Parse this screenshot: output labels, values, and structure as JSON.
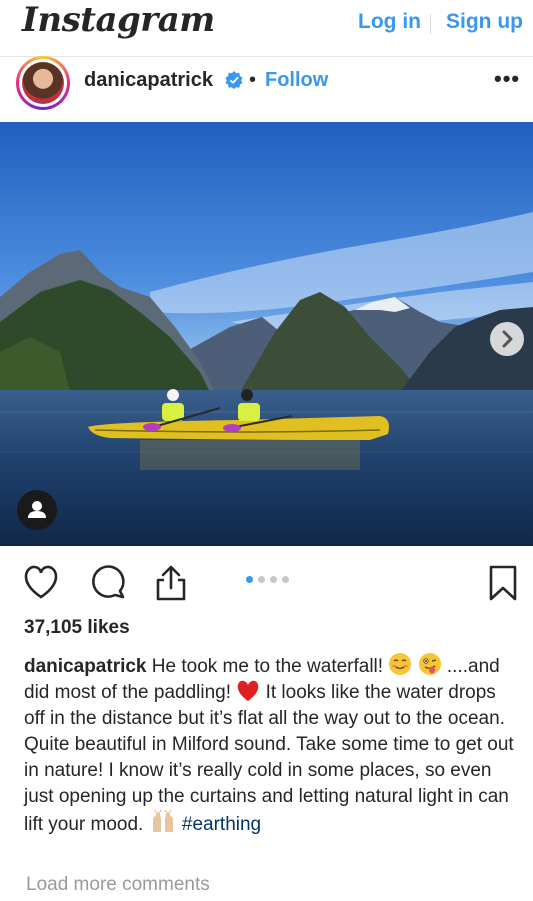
{
  "header": {
    "logo": "Instagram",
    "login": "Log in",
    "signup": "Sign up"
  },
  "post": {
    "username": "danicapatrick",
    "dot": "•",
    "follow": "Follow",
    "more": "•••",
    "carousel": {
      "total": 4,
      "active": 1
    }
  },
  "likes": "37,105 likes",
  "caption": {
    "username": "danicapatrick",
    "text1": " He took me to the waterfall! ",
    "text2": " ....and did most of the paddling! ",
    "text3": " It looks like the water drops off in the distance but it’s flat all the way out to the ocean. Quite beautiful in Milford sound. Take some time to get out in nature! I know it’s really cold in some places, so even just opening up the curtains and letting natural light in can lift your mood. ",
    "hashtag": "#earthing"
  },
  "load_more": "Load more comments",
  "icons": [
    "verified-badge-icon",
    "more-options-icon",
    "next-arrow-icon",
    "user-tag-icon",
    "heart-icon",
    "comment-icon",
    "share-icon",
    "bookmark-icon",
    "smiling-face-emoji",
    "winking-tongue-emoji",
    "red-heart-emoji",
    "raised-hands-emoji"
  ],
  "colors": {
    "link": "#3897f0",
    "hashtag": "#003569",
    "text": "#262626",
    "muted": "#999999"
  }
}
